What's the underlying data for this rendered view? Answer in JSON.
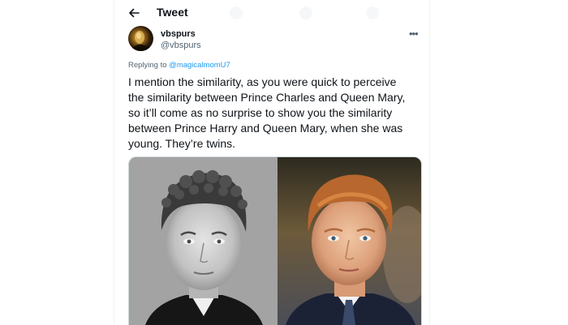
{
  "header": {
    "title": "Tweet",
    "back_icon": "arrow-left-icon"
  },
  "author": {
    "display_name": "vbspurs",
    "handle": "@vbspurs"
  },
  "more_label": "•••",
  "reply": {
    "prefix": "Replying to ",
    "mention": "@magicalmomU7"
  },
  "tweet": {
    "lines": [
      "I mention the similarity, as you were quick to perceive",
      "the similarity between Prince Charles and Queen Mary,",
      "so it’ll come as no surprise to show you the similarity",
      "between Prince Harry and Queen Mary, when she was",
      "young. They’re twins."
    ]
  },
  "colors": {
    "text": "#0f1419",
    "secondary": "#536471",
    "link": "#1d9bf0",
    "border": "#cfd9de"
  }
}
